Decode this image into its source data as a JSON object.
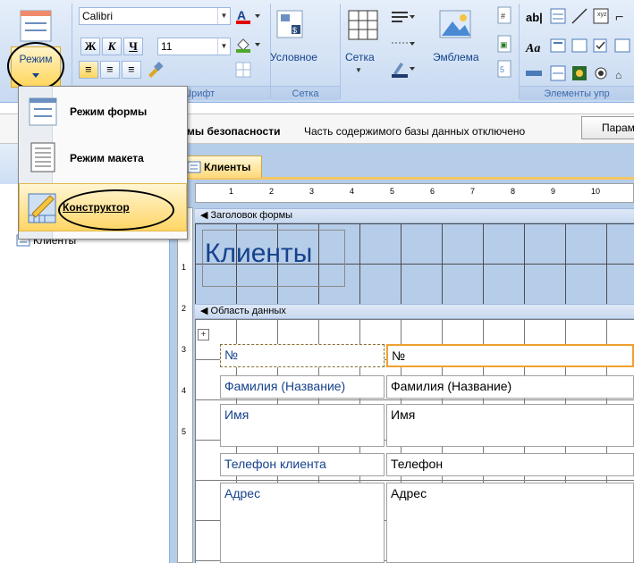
{
  "ribbon": {
    "mode_button_label": "Режим",
    "font_name": "Calibri",
    "font_size": "11",
    "bold_label": "Ж",
    "italic_label": "К",
    "underline_label": "Ч",
    "font_group_label": "Шрифт",
    "conditional_label": "Условное",
    "grid_button_label": "Сетка",
    "grid_group_label": "Сетка",
    "logo_label": "Эмблема",
    "controls_group_label": "Элементы упр"
  },
  "mode_menu": {
    "items": [
      {
        "label": "Режим формы",
        "icon": "form-view-icon"
      },
      {
        "label": "Режим макета",
        "icon": "layout-view-icon"
      },
      {
        "label": "Конструктор",
        "icon": "design-view-icon"
      }
    ]
  },
  "security_bar": {
    "bold_text": "мы безопасности",
    "text": "Часть содержимого базы данных отключено",
    "button_label": "Парам"
  },
  "nav_pane": {
    "item_label": "Клиенты"
  },
  "document": {
    "tab_label": "Клиенты",
    "header_section_label": "Заголовок формы",
    "form_title": "Клиенты",
    "detail_section_label": "Область данных",
    "fields": [
      {
        "label": "№",
        "value": "№"
      },
      {
        "label": "Фамилия (Название)",
        "value": "Фамилия (Название)"
      },
      {
        "label": "Имя",
        "value": "Имя"
      },
      {
        "label": "Телефон клиента",
        "value": "Телефон"
      },
      {
        "label": "Адрес",
        "value": "Адрес"
      }
    ],
    "ruler_marks": [
      "1",
      "2",
      "3",
      "4",
      "5",
      "6",
      "7",
      "8",
      "9",
      "10"
    ],
    "vruler_marks": [
      "1",
      "2",
      "3",
      "4",
      "5"
    ]
  },
  "colors": {
    "accent": "#f0a030",
    "ribbon_bg": "#d5e3f5",
    "form_header_bg": "#b6cdea"
  }
}
